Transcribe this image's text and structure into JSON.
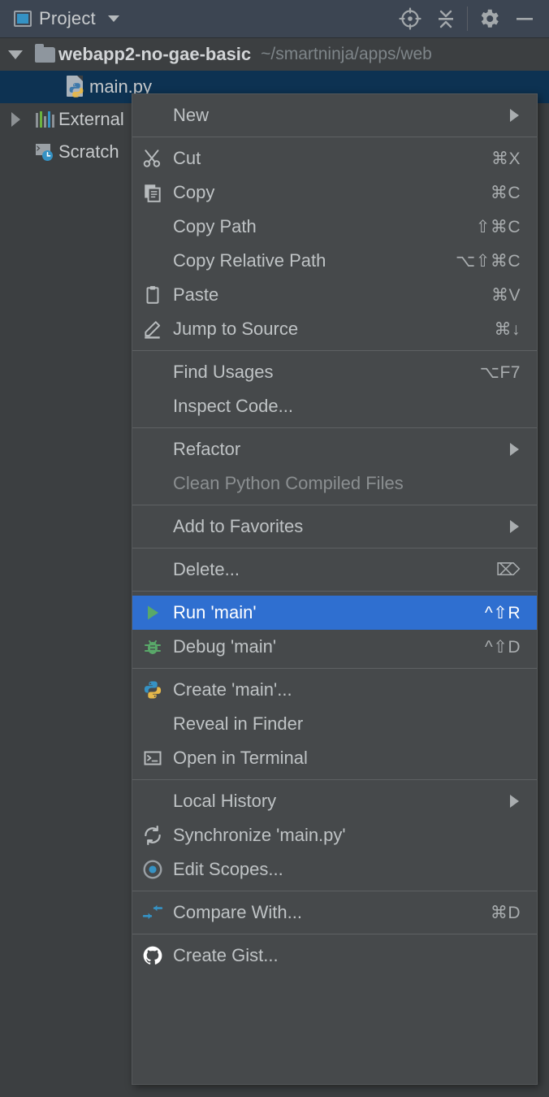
{
  "window": {
    "toolwindow_title": "Project",
    "toolbar": [
      {
        "name": "locate-icon",
        "label": "Select Opened File"
      },
      {
        "name": "collapse-all-icon",
        "label": "Collapse All"
      },
      {
        "name": "gear-icon",
        "label": "Settings"
      },
      {
        "name": "minimize-icon",
        "label": "Hide"
      }
    ]
  },
  "tree": {
    "rows": [
      {
        "label": "webapp2-no-gae-basic",
        "path": "~/smartninja/apps/web",
        "icon": "folder-icon",
        "expanded": true,
        "selected": false
      },
      {
        "label": "main.py",
        "path": "",
        "icon": "python-file-icon",
        "expanded": null,
        "selected": true
      },
      {
        "label": "External",
        "path": "",
        "icon": "libraries-icon",
        "expanded": false,
        "selected": false
      },
      {
        "label": "Scratch",
        "path": "",
        "icon": "scratches-icon",
        "expanded": null,
        "selected": false
      }
    ]
  },
  "context_menu": {
    "items": [
      {
        "label": "New",
        "accel": "",
        "icon": "",
        "submenu": true,
        "selected": false,
        "disabled": false
      },
      {
        "separator": true
      },
      {
        "label": "Cut",
        "accel": "⌘X",
        "icon": "scissors-icon",
        "submenu": false,
        "selected": false,
        "disabled": false
      },
      {
        "label": "Copy",
        "accel": "⌘C",
        "icon": "copy-icon",
        "submenu": false,
        "selected": false,
        "disabled": false
      },
      {
        "label": "Copy Path",
        "accel": "⇧⌘C",
        "icon": "",
        "submenu": false,
        "selected": false,
        "disabled": false
      },
      {
        "label": "Copy Relative Path",
        "accel": "⌥⇧⌘C",
        "icon": "",
        "submenu": false,
        "selected": false,
        "disabled": false
      },
      {
        "label": "Paste",
        "accel": "⌘V",
        "icon": "clipboard-icon",
        "submenu": false,
        "selected": false,
        "disabled": false
      },
      {
        "label": "Jump to Source",
        "accel": "⌘↓",
        "icon": "pencil-icon",
        "submenu": false,
        "selected": false,
        "disabled": false
      },
      {
        "separator": true
      },
      {
        "label": "Find Usages",
        "accel": "⌥F7",
        "icon": "",
        "submenu": false,
        "selected": false,
        "disabled": false
      },
      {
        "label": "Inspect Code...",
        "accel": "",
        "icon": "",
        "submenu": false,
        "selected": false,
        "disabled": false
      },
      {
        "separator": true
      },
      {
        "label": "Refactor",
        "accel": "",
        "icon": "",
        "submenu": true,
        "selected": false,
        "disabled": false
      },
      {
        "label": "Clean Python Compiled Files",
        "accel": "",
        "icon": "",
        "submenu": false,
        "selected": false,
        "disabled": true
      },
      {
        "separator": true
      },
      {
        "label": "Add to Favorites",
        "accel": "",
        "icon": "",
        "submenu": true,
        "selected": false,
        "disabled": false
      },
      {
        "separator": true
      },
      {
        "label": "Delete...",
        "accel": "⌦",
        "icon": "",
        "submenu": false,
        "selected": false,
        "disabled": false
      },
      {
        "separator": true
      },
      {
        "label": "Run 'main'",
        "accel": "^⇧R",
        "icon": "run-icon",
        "submenu": false,
        "selected": true,
        "disabled": false
      },
      {
        "label": "Debug 'main'",
        "accel": "^⇧D",
        "icon": "debug-icon",
        "submenu": false,
        "selected": false,
        "disabled": false
      },
      {
        "separator": true
      },
      {
        "label": "Create 'main'...",
        "accel": "",
        "icon": "python-icon",
        "submenu": false,
        "selected": false,
        "disabled": false
      },
      {
        "label": "Reveal in Finder",
        "accel": "",
        "icon": "",
        "submenu": false,
        "selected": false,
        "disabled": false
      },
      {
        "label": "Open in Terminal",
        "accel": "",
        "icon": "terminal-icon",
        "submenu": false,
        "selected": false,
        "disabled": false
      },
      {
        "separator": true
      },
      {
        "label": "Local History",
        "accel": "",
        "icon": "",
        "submenu": true,
        "selected": false,
        "disabled": false
      },
      {
        "label": "Synchronize 'main.py'",
        "accel": "",
        "icon": "refresh-icon",
        "submenu": false,
        "selected": false,
        "disabled": false
      },
      {
        "label": "Edit Scopes...",
        "accel": "",
        "icon": "scopes-icon",
        "submenu": false,
        "selected": false,
        "disabled": false
      },
      {
        "separator": true
      },
      {
        "label": "Compare With...",
        "accel": "⌘D",
        "icon": "compare-icon",
        "submenu": false,
        "selected": false,
        "disabled": false
      },
      {
        "separator": true
      },
      {
        "label": "Create Gist...",
        "accel": "",
        "icon": "github-icon",
        "submenu": false,
        "selected": false,
        "disabled": false
      }
    ]
  },
  "colors": {
    "header_bg": "#3c4552",
    "panel_bg": "#3c3f41",
    "menu_bg": "#46494b",
    "selection_blue": "#2f6fd0",
    "tree_selection": "#0d3252",
    "text": "#bfc3c5",
    "text_disabled": "#8b8f91",
    "accent_green": "#59a869",
    "accent_blue": "#3592c4"
  }
}
